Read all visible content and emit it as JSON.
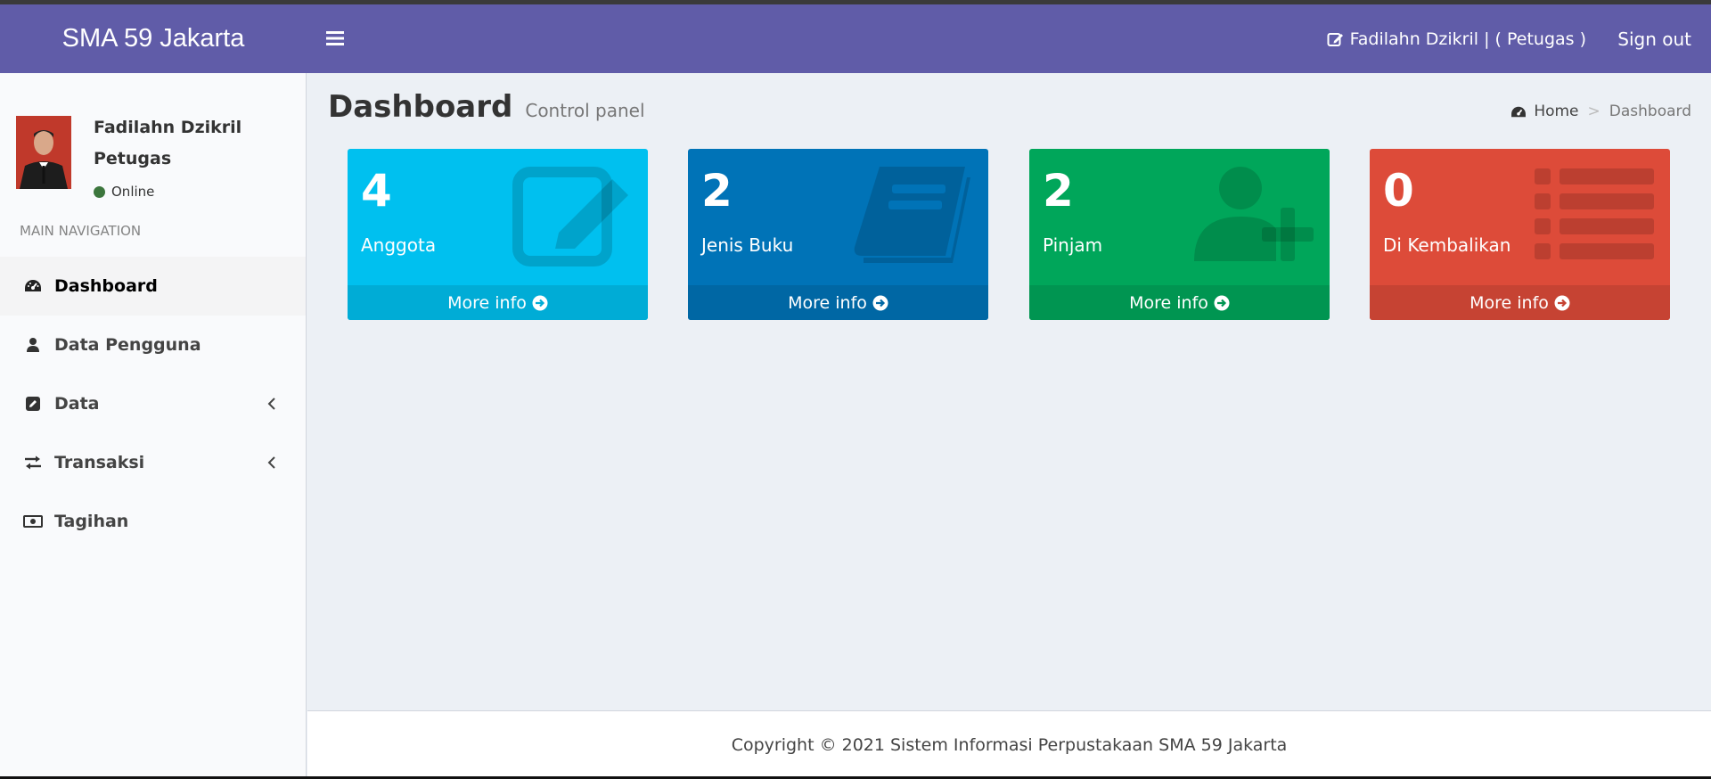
{
  "header": {
    "brand": "SMA 59 Jakarta",
    "user_label": "Fadilahn Dzikril | ( Petugas )",
    "signout_label": "Sign out",
    "color": "#605ca8"
  },
  "sidebar": {
    "user": {
      "name": "Fadilahn Dzikril",
      "role": "Petugas",
      "status": "Online"
    },
    "nav_header": "MAIN NAVIGATION",
    "items": [
      {
        "label": "Dashboard",
        "icon": "dashboard-icon",
        "active": true
      },
      {
        "label": "Data Pengguna",
        "icon": "user-icon"
      },
      {
        "label": "Data",
        "icon": "edit-icon",
        "has_submenu": true
      },
      {
        "label": "Transaksi",
        "icon": "exchange-icon",
        "has_submenu": true
      },
      {
        "label": "Tagihan",
        "icon": "money-icon"
      }
    ]
  },
  "content": {
    "title": "Dashboard",
    "subtitle": "Control panel",
    "breadcrumb": {
      "home": "Home",
      "separator": ">",
      "current": "Dashboard"
    }
  },
  "boxes": [
    {
      "value": "4",
      "label": "Anggota",
      "footer": "More info",
      "color": "#00c0ef",
      "footer_color": "#00acd6",
      "icon": "edit-icon"
    },
    {
      "value": "2",
      "label": "Jenis Buku",
      "footer": "More info",
      "color": "#0073b7",
      "footer_color": "#0067a4",
      "icon": "book-icon"
    },
    {
      "value": "2",
      "label": "Pinjam",
      "footer": "More info",
      "color": "#00a65a",
      "footer_color": "#009551",
      "icon": "user-plus-icon"
    },
    {
      "value": "0",
      "label": "Di Kembalikan",
      "footer": "More info",
      "color": "#dd4b39",
      "footer_color": "#c64333",
      "icon": "list-icon"
    }
  ],
  "footer": {
    "copyright": "Copyright © 2021 Sistem Informasi Perpustakaan SMA 59 Jakarta"
  }
}
